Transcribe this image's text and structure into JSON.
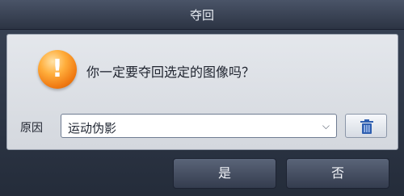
{
  "window": {
    "title": "夺回"
  },
  "dialog": {
    "icon": "warning-icon",
    "message": "你一定要夺回选定的图像吗？",
    "reason": {
      "label": "原因",
      "selected": "运动伪影",
      "dropdown_icon": "chevron-down-icon",
      "delete_icon": "trash-icon"
    },
    "buttons": {
      "yes": "是",
      "no": "否"
    }
  },
  "colors": {
    "titlebar": "#3b4456",
    "panel": "#dfe3e8",
    "warning": "#f08a1a",
    "button": "#4a5467",
    "trash": "#2f5fb0"
  }
}
